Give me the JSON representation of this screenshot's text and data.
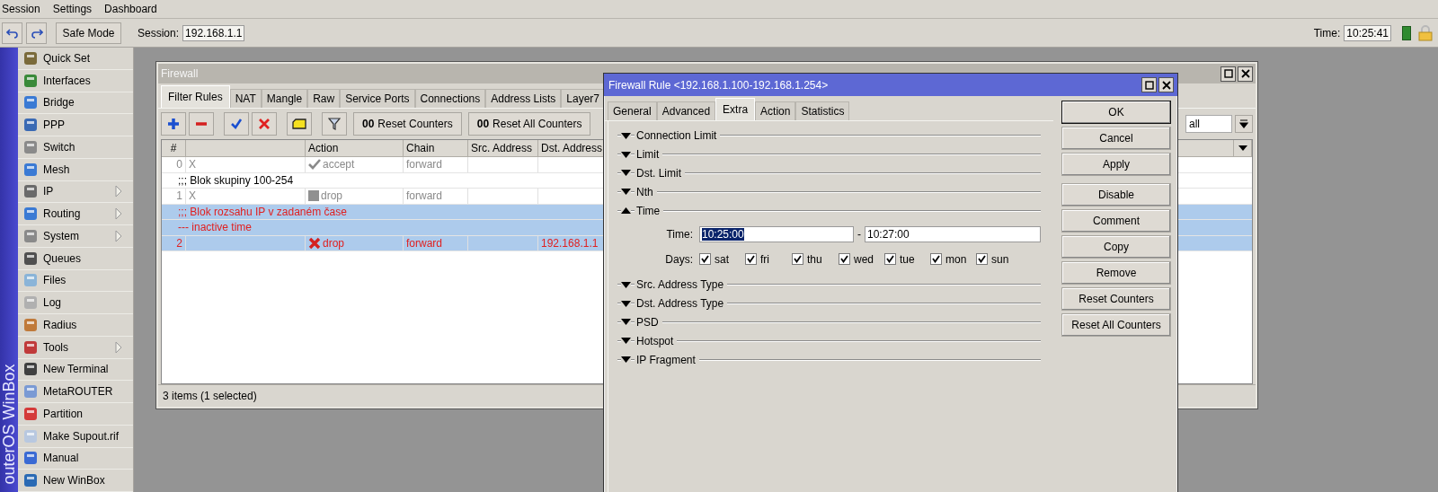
{
  "menubar": [
    "Session",
    "Settings",
    "Dashboard"
  ],
  "toolbar": {
    "safe_mode": "Safe Mode",
    "session_label": "Session:",
    "session_value": "192.168.1.1",
    "time_label": "Time:",
    "time_value": "10:25:41"
  },
  "sidebar": {
    "brand": "outerOS WinBox",
    "items": [
      {
        "label": "Quick Set",
        "submenu": false
      },
      {
        "label": "Interfaces",
        "submenu": false
      },
      {
        "label": "Bridge",
        "submenu": false
      },
      {
        "label": "PPP",
        "submenu": false
      },
      {
        "label": "Switch",
        "submenu": false
      },
      {
        "label": "Mesh",
        "submenu": false
      },
      {
        "label": "IP",
        "submenu": true
      },
      {
        "label": "Routing",
        "submenu": true
      },
      {
        "label": "System",
        "submenu": true
      },
      {
        "label": "Queues",
        "submenu": false
      },
      {
        "label": "Files",
        "submenu": false
      },
      {
        "label": "Log",
        "submenu": false
      },
      {
        "label": "Radius",
        "submenu": false
      },
      {
        "label": "Tools",
        "submenu": true
      },
      {
        "label": "New Terminal",
        "submenu": false
      },
      {
        "label": "MetaROUTER",
        "submenu": false
      },
      {
        "label": "Partition",
        "submenu": false
      },
      {
        "label": "Make Supout.rif",
        "submenu": false
      },
      {
        "label": "Manual",
        "submenu": false
      },
      {
        "label": "New WinBox",
        "submenu": false
      }
    ]
  },
  "firewall": {
    "title": "Firewall",
    "tabs": [
      {
        "label": "Filter Rules",
        "selected": true
      },
      {
        "label": "NAT",
        "selected": false
      },
      {
        "label": "Mangle",
        "selected": false
      },
      {
        "label": "Raw",
        "selected": false
      },
      {
        "label": "Service Ports",
        "selected": false
      },
      {
        "label": "Connections",
        "selected": false
      },
      {
        "label": "Address Lists",
        "selected": false
      },
      {
        "label": "Layer7",
        "selected": false
      }
    ],
    "tools": [
      {
        "kind": "add"
      },
      {
        "kind": "remove"
      },
      {
        "kind": "enable"
      },
      {
        "kind": "disable"
      },
      {
        "kind": "comment"
      },
      {
        "kind": "filter"
      },
      {
        "kind": "text",
        "prefix": "00",
        "label": "Reset Counters"
      },
      {
        "kind": "text",
        "prefix": "00",
        "label": "Reset All Counters"
      }
    ],
    "filter_value": "all",
    "table": {
      "columns": [
        "#",
        "",
        "Action",
        "Chain",
        "Src. Address",
        "Dst. Address"
      ],
      "rows": [
        {
          "kind": "rule",
          "number": "0",
          "column_2": "X",
          "action": {
            "kind": "accept",
            "label": "accept"
          },
          "chain": "forward",
          "dst_address": "",
          "disabled": true,
          "invalid": false,
          "selected": false
        },
        {
          "kind": "comment",
          "text": ";;; Blok skupiny 100-254",
          "invalid": false,
          "selected": false
        },
        {
          "kind": "rule",
          "number": "1",
          "column_2": "X",
          "action": {
            "kind": "drop",
            "label": "drop"
          },
          "chain": "forward",
          "dst_address": "",
          "disabled": true,
          "invalid": false,
          "selected": false
        },
        {
          "kind": "comment",
          "text": ";;; Blok rozsahu IP v zadaném čase",
          "invalid": true,
          "selected": true
        },
        {
          "kind": "comment",
          "text": "--- inactive time",
          "invalid": true,
          "selected": true
        },
        {
          "kind": "rule",
          "number": "2",
          "column_2": "",
          "action": {
            "kind": "drop",
            "label": "drop"
          },
          "chain": "forward",
          "dst_address": "192.168.1.1",
          "disabled": false,
          "invalid": true,
          "selected": true
        }
      ]
    },
    "status": "3 items (1 selected)"
  },
  "dialog": {
    "title": "Firewall Rule <192.168.1.100-192.168.1.254>",
    "tabs": [
      {
        "label": "General",
        "selected": false
      },
      {
        "label": "Advanced",
        "selected": false
      },
      {
        "label": "Extra",
        "selected": true
      },
      {
        "label": "Action",
        "selected": false
      },
      {
        "label": "Statistics",
        "selected": false
      }
    ],
    "sections": [
      {
        "label": "Connection Limit",
        "expanded": false
      },
      {
        "label": "Limit",
        "expanded": false
      },
      {
        "label": "Dst. Limit",
        "expanded": false
      },
      {
        "label": "Nth",
        "expanded": false
      },
      {
        "label": "Time",
        "expanded": true,
        "time": {
          "label": "Time:",
          "from": "10:25:00",
          "from_selected": true,
          "separator": "-",
          "to": "10:27:00",
          "days_label": "Days:",
          "days": [
            {
              "label": "sat",
              "checked": true
            },
            {
              "label": "fri",
              "checked": true
            },
            {
              "label": "thu",
              "checked": true
            },
            {
              "label": "wed",
              "checked": true
            },
            {
              "label": "tue",
              "checked": true
            },
            {
              "label": "mon",
              "checked": true
            },
            {
              "label": "sun",
              "checked": true
            }
          ]
        }
      },
      {
        "label": "Src. Address Type",
        "expanded": false
      },
      {
        "label": "Dst. Address Type",
        "expanded": false
      },
      {
        "label": "PSD",
        "expanded": false
      },
      {
        "label": "Hotspot",
        "expanded": false
      },
      {
        "label": "IP Fragment",
        "expanded": false
      }
    ],
    "button_groups": [
      [
        {
          "label": "OK",
          "default": true
        },
        {
          "label": "Cancel",
          "default": false
        },
        {
          "label": "Apply",
          "default": false
        }
      ],
      [
        {
          "label": "Disable",
          "default": false
        },
        {
          "label": "Comment",
          "default": false
        },
        {
          "label": "Copy",
          "default": false
        },
        {
          "label": "Remove",
          "default": false
        },
        {
          "label": "Reset Counters",
          "default": false
        },
        {
          "label": "Reset All Counters",
          "default": false
        }
      ]
    ]
  }
}
